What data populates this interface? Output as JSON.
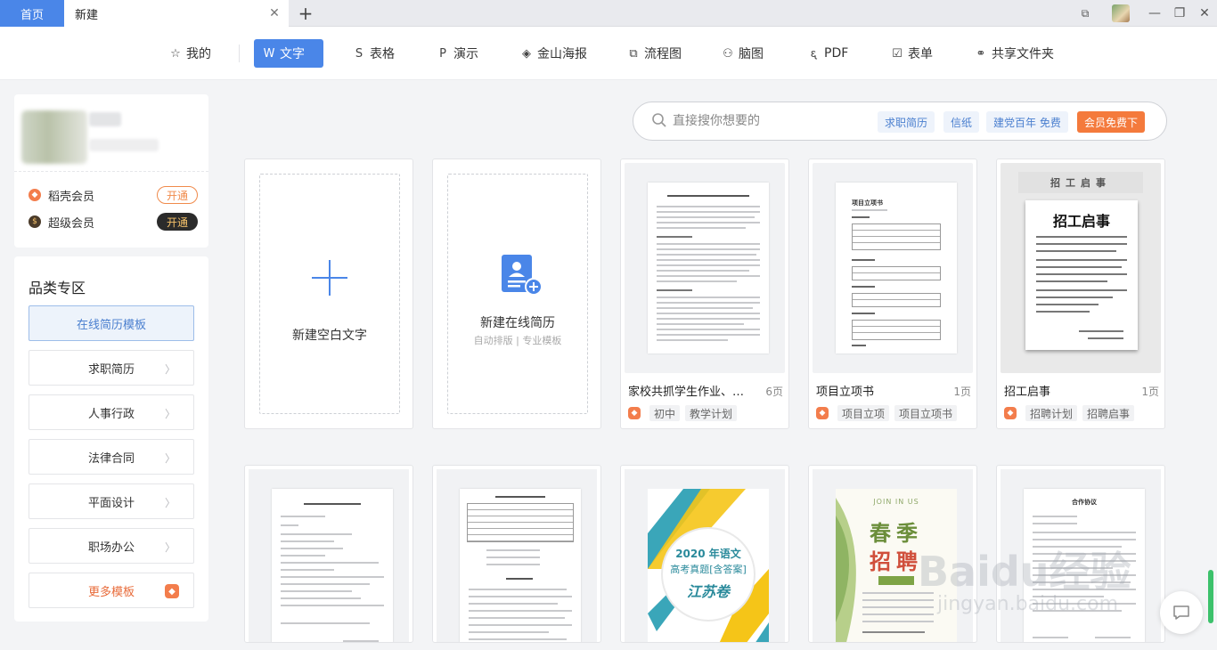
{
  "tabs": {
    "home": "首页",
    "current": "新建"
  },
  "nav": [
    {
      "label": "我的",
      "icon": "star-icon",
      "glyph": "☆"
    },
    {
      "label": "文字",
      "icon": "writer-icon",
      "glyph": "W",
      "active": true
    },
    {
      "label": "表格",
      "icon": "sheet-icon",
      "glyph": "S"
    },
    {
      "label": "演示",
      "icon": "present-icon",
      "glyph": "P"
    },
    {
      "label": "金山海报",
      "icon": "poster-icon",
      "glyph": "◈"
    },
    {
      "label": "流程图",
      "icon": "flowchart-icon",
      "glyph": "⧉"
    },
    {
      "label": "脑图",
      "icon": "mindmap-icon",
      "glyph": "⚇"
    },
    {
      "label": "PDF",
      "icon": "pdf-icon",
      "glyph": "ᶓ"
    },
    {
      "label": "表单",
      "icon": "form-icon",
      "glyph": "☑"
    },
    {
      "label": "共享文件夹",
      "icon": "share-folder-icon",
      "glyph": "⚭"
    }
  ],
  "membership": {
    "rows": [
      {
        "label": "稻壳会员",
        "button": "开通"
      },
      {
        "label": "超级会员",
        "button": "开通"
      }
    ]
  },
  "category": {
    "title": "品类专区",
    "items": [
      "在线简历模板",
      "求职简历",
      "人事行政",
      "法律合同",
      "平面设计",
      "职场办公",
      "更多模板"
    ]
  },
  "search": {
    "placeholder": "直接搜你想要的",
    "tags": [
      "求职简历",
      "信纸",
      "建党百年 免费",
      "会员免费下"
    ]
  },
  "new_blank": {
    "label": "新建空白文字"
  },
  "new_resume": {
    "label": "新建在线简历",
    "sub": "自动排版 | 专业模板"
  },
  "templates": [
    {
      "title": "家校共抓学生作业、手...",
      "pages": "6页",
      "tags": [
        "初中",
        "教学计划"
      ]
    },
    {
      "title": "项目立项书",
      "pages": "1页",
      "tags": [
        "项目立项",
        "项目立项书"
      ]
    },
    {
      "title": "招工启事",
      "pages": "1页",
      "tags": [
        "招聘计划",
        "招聘启事"
      ]
    }
  ],
  "thumb_text": {
    "poster_strip": "招工启事",
    "poster_big": "招工启事",
    "chinese_line1": "2020 年语文",
    "chinese_line2": "高考真题[含答案]",
    "chinese_line3": "江苏卷",
    "spring_line1": "JOIN IN US",
    "spring_big": "春季",
    "spring_big2": "招聘",
    "contract_title": "合作协议",
    "project_title": "项目立项书"
  },
  "watermark": {
    "main": "Baidu经验",
    "sub": "jingyan.baidu.com"
  },
  "colors": {
    "accent": "#4a86e8",
    "orange": "#f37d4c"
  }
}
